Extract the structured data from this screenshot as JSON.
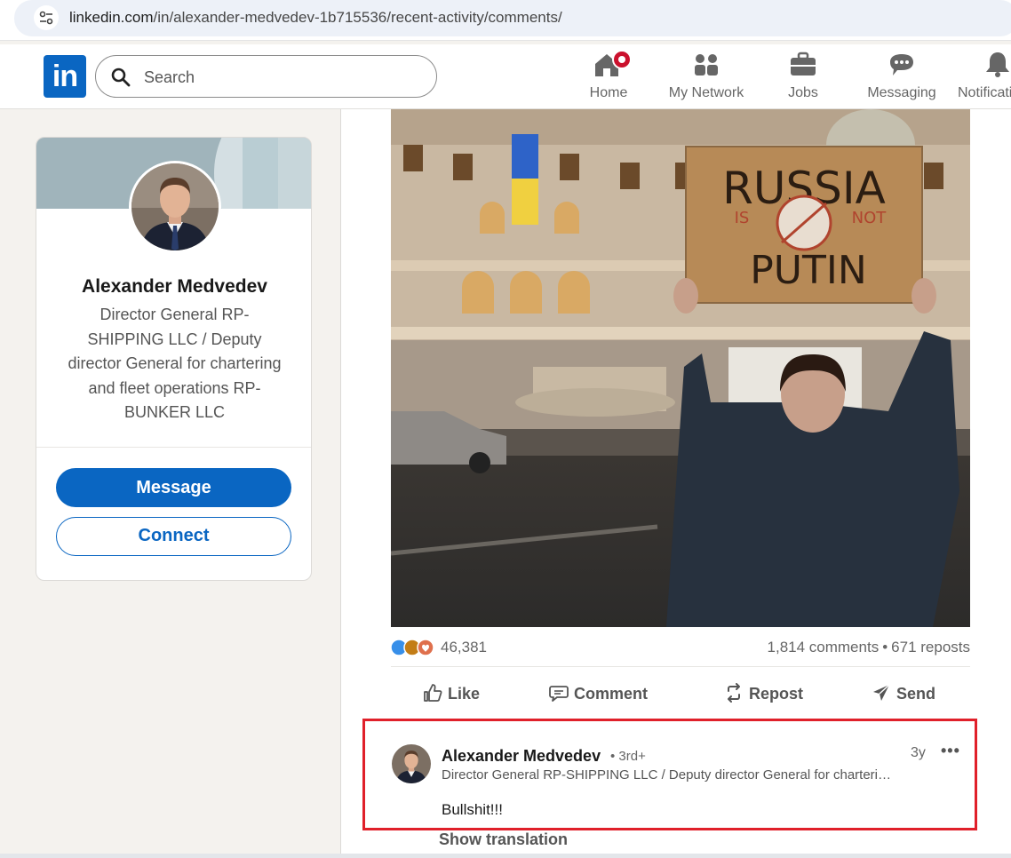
{
  "browser": {
    "url_host": "linkedin.com",
    "url_path": "/in/alexander-medvedev-1b715536/recent-activity/comments/"
  },
  "nav": {
    "logo": "in",
    "search_placeholder": "Search",
    "items": [
      {
        "label": "Home",
        "icon": "home-icon",
        "has_badge": true
      },
      {
        "label": "My Network",
        "icon": "people-icon"
      },
      {
        "label": "Jobs",
        "icon": "briefcase-icon"
      },
      {
        "label": "Messaging",
        "icon": "chat-icon"
      },
      {
        "label": "Notifications",
        "icon": "bell-icon"
      }
    ]
  },
  "profile": {
    "name": "Alexander Medvedev",
    "headline": "Director General RP-SHIPPING LLC / Deputy director General for chartering and fleet operations RP-BUNKER LLC",
    "message_label": "Message",
    "connect_label": "Connect"
  },
  "post": {
    "image_sign_text": [
      "RUSSIA",
      "IS",
      "NOT",
      "PUTIN"
    ],
    "reaction_count": "46,381",
    "comments_count": "1,814 comments",
    "reposts_count": "671 reposts",
    "actions": {
      "like": "Like",
      "comment": "Comment",
      "repost": "Repost",
      "send": "Send"
    }
  },
  "comment": {
    "author": "Alexander Medvedev",
    "degree": "• 3rd+",
    "headline": "Director General RP-SHIPPING LLC / Deputy director General for chartering and fleet operations RP-BUNKER LLC",
    "time": "3y",
    "more": "•••",
    "text": "Bullshit!!!",
    "show_translation": "Show translation"
  },
  "colors": {
    "linkedin_blue": "#0a66c2",
    "highlight_red": "#e0202a",
    "badge_red": "#cb112d"
  }
}
